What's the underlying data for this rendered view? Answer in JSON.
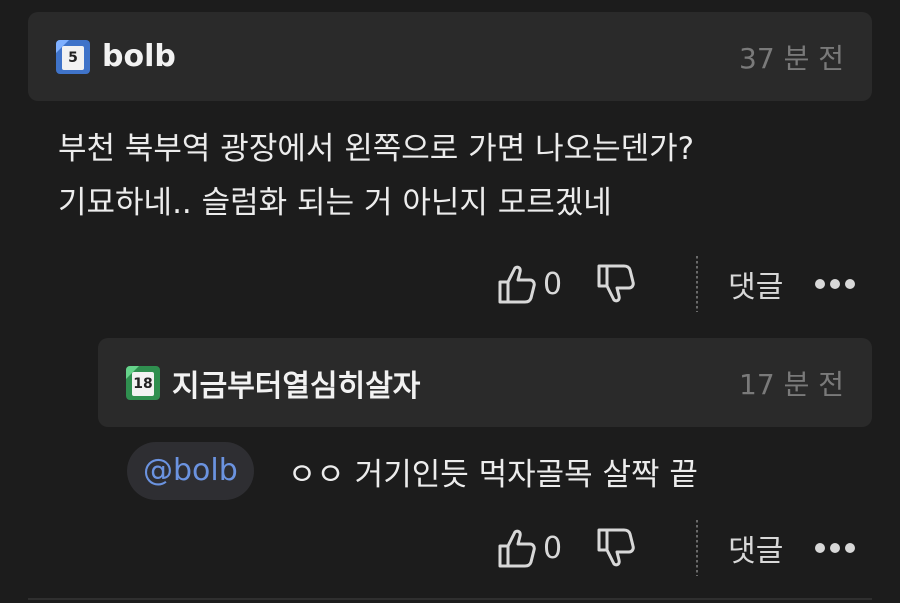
{
  "comment": {
    "username": "bolb",
    "level_badge": "5",
    "badge_color": "#3f73c9",
    "time": "37 분 전",
    "text_lines": [
      "부천 북부역 광장에서 왼쪽으로 가면 나오는덴가?",
      "기묘하네.. 슬럼화 되는 거 아닌지 모르겠네"
    ],
    "like_count": "0",
    "reply_label": "댓글"
  },
  "reply": {
    "username": "지금부터열심히살자",
    "level_badge": "18",
    "badge_color": "#2f8f4f",
    "time": "17 분 전",
    "mention": "@bolb",
    "text": "ㅇㅇ 거기인듯 먹자골목 살짝 끝",
    "like_count": "0",
    "reply_label": "댓글"
  },
  "icons": {
    "like": "thumbs-up-icon",
    "dislike": "thumbs-down-icon",
    "more": "more-dots-icon"
  },
  "colors": {
    "background": "#1c1c1c",
    "header_bg": "#2a2a2a",
    "mention": "#6b93e0"
  }
}
